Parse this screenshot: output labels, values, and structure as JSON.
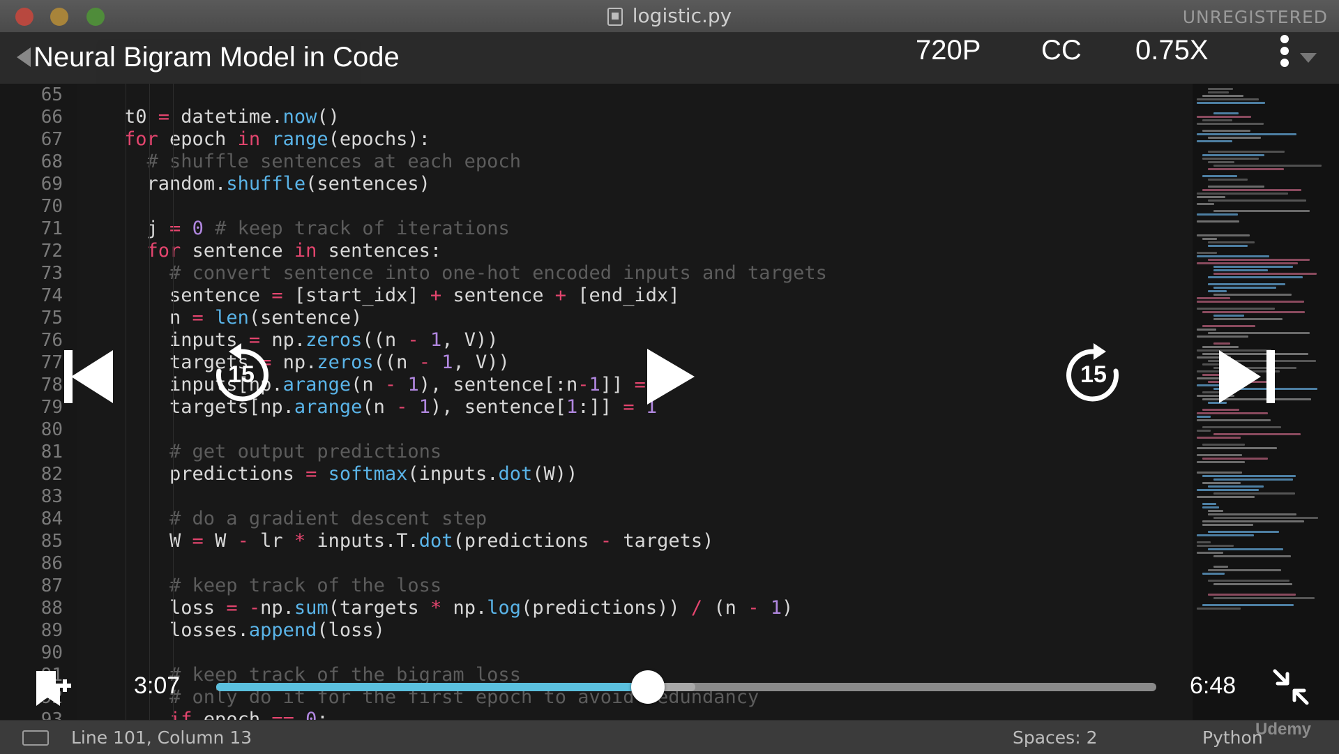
{
  "window": {
    "title": "logistic.py",
    "license_status": "UNREGISTERED"
  },
  "player": {
    "video_title": "Neural Bigram Model in Code",
    "quality": "720P",
    "captions": "CC",
    "speed": "0.75X",
    "skip_back_seconds": "15",
    "skip_forward_seconds": "15",
    "current_time": "3:07",
    "duration": "6:48",
    "progress_fraction": 0.459,
    "buffered_fraction": 0.51,
    "watermark": "Udemy"
  },
  "editor": {
    "lines": [
      {
        "num": "65",
        "text": ""
      },
      {
        "num": "66",
        "text": "t0 = datetime.now()"
      },
      {
        "num": "67",
        "text": "for epoch in range(epochs):"
      },
      {
        "num": "68",
        "text": "  # shuffle sentences at each epoch"
      },
      {
        "num": "69",
        "text": "  random.shuffle(sentences)"
      },
      {
        "num": "70",
        "text": ""
      },
      {
        "num": "71",
        "text": "  j = 0 # keep track of iterations"
      },
      {
        "num": "72",
        "text": "  for sentence in sentences:"
      },
      {
        "num": "73",
        "text": "    # convert sentence into one-hot encoded inputs and targets"
      },
      {
        "num": "74",
        "text": "    sentence = [start_idx] + sentence + [end_idx]"
      },
      {
        "num": "75",
        "text": "    n = len(sentence)"
      },
      {
        "num": "76",
        "text": "    inputs = np.zeros((n - 1, V))"
      },
      {
        "num": "77",
        "text": "    targets = np.zeros((n - 1, V))"
      },
      {
        "num": "78",
        "text": "    inputs[np.arange(n - 1), sentence[:n-1]] = 1"
      },
      {
        "num": "79",
        "text": "    targets[np.arange(n - 1), sentence[1:]] = 1"
      },
      {
        "num": "80",
        "text": ""
      },
      {
        "num": "81",
        "text": "    # get output predictions"
      },
      {
        "num": "82",
        "text": "    predictions = softmax(inputs.dot(W))"
      },
      {
        "num": "83",
        "text": ""
      },
      {
        "num": "84",
        "text": "    # do a gradient descent step"
      },
      {
        "num": "85",
        "text": "    W = W - lr * inputs.T.dot(predictions - targets)"
      },
      {
        "num": "86",
        "text": ""
      },
      {
        "num": "87",
        "text": "    # keep track of the loss"
      },
      {
        "num": "88",
        "text": "    loss = -np.sum(targets * np.log(predictions)) / (n - 1)"
      },
      {
        "num": "89",
        "text": "    losses.append(loss)"
      },
      {
        "num": "90",
        "text": ""
      },
      {
        "num": "91",
        "text": "    # keep track of the bigram loss"
      },
      {
        "num": "92",
        "text": "    # only do it for the first epoch to avoid redundancy"
      },
      {
        "num": "93",
        "text": "    if epoch == 0:"
      }
    ],
    "keywords": [
      "for",
      "in",
      "if"
    ],
    "builtin_functions": [
      "now",
      "range",
      "shuffle",
      "len",
      "zeros",
      "arange",
      "softmax",
      "dot",
      "sum",
      "log",
      "append"
    ]
  },
  "statusbar": {
    "position": "Line 101, Column 13",
    "spaces": "Spaces: 2",
    "language": "Python"
  },
  "colors": {
    "keyword": "#e3456e",
    "function": "#5ab4e8",
    "number": "#b187e0",
    "comment": "#5c5c5c",
    "progress": "#5bc0de"
  }
}
